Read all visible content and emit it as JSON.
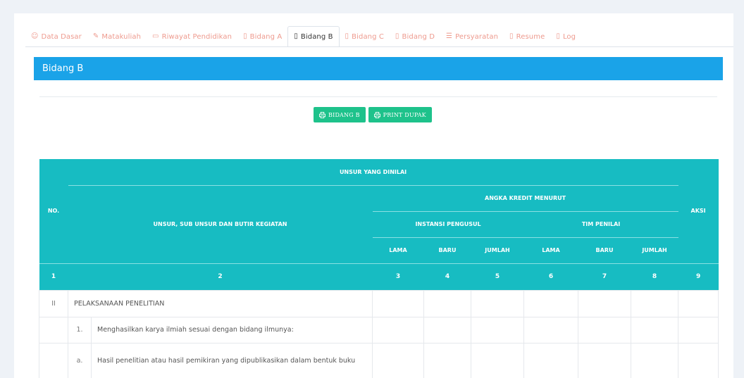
{
  "tabs": [
    {
      "label": "Data Dasar",
      "icon": "user-icon",
      "glyph": "👤"
    },
    {
      "label": "Matakuliah",
      "icon": "edit-icon",
      "glyph": "✎"
    },
    {
      "label": "Riwayat Pendidikan",
      "icon": "book-icon",
      "glyph": "▭"
    },
    {
      "label": "Bidang A",
      "icon": "doc-icon",
      "glyph": "▯"
    },
    {
      "label": "Bidang B",
      "icon": "doc-icon",
      "glyph": "▯",
      "active": true
    },
    {
      "label": "Bidang C",
      "icon": "doc-icon",
      "glyph": "▯"
    },
    {
      "label": "Bidang D",
      "icon": "doc-icon",
      "glyph": "▯"
    },
    {
      "label": "Persyaratan",
      "icon": "list-icon",
      "glyph": "☰"
    },
    {
      "label": "Resume",
      "icon": "file-icon",
      "glyph": "▯"
    },
    {
      "label": "Log",
      "icon": "log-icon",
      "glyph": "▯"
    }
  ],
  "panel": {
    "title": "Bidang B"
  },
  "buttons": {
    "bidang_b": "BIDANG B",
    "print_dupak": "PRINT DUPAK",
    "icon": "print-icon"
  },
  "table": {
    "headers": {
      "no": "NO.",
      "unsur_dinilai": "UNSUR YANG DINILAI",
      "unsur_sub": "UNSUR, SUB UNSUR DAN BUTIR KEGIATAN",
      "angka_kredit": "ANGKA KREDIT MENURUT",
      "instansi": "INSTANSI PENGUSUL",
      "tim": "TIM PENILAI",
      "aksi": "AKSI",
      "lama1": "LAMA",
      "baru1": "BARU",
      "jumlah1": "JUMLAH",
      "lama2": "LAMA",
      "baru2": "BARU",
      "jumlah2": "JUMLAH"
    },
    "index_row": [
      "1",
      "2",
      "3",
      "4",
      "5",
      "6",
      "7",
      "8",
      "9"
    ],
    "rows": [
      {
        "no": "II",
        "text": "PELAKSANAAN PENELITIAN"
      },
      {
        "sub": "1.",
        "text": "Menghasilkan karya ilmiah sesuai dengan bidang ilmunya:"
      },
      {
        "sub": "a.",
        "text": "Hasil penelitian atau hasil pemikiran yang dipublikasikan dalam bentuk buku"
      }
    ]
  },
  "colors": {
    "header_bg": "#1aa3e8",
    "table_header": "#17bcc2",
    "button": "#1ec28b",
    "tab_text": "#ee9a8e"
  }
}
